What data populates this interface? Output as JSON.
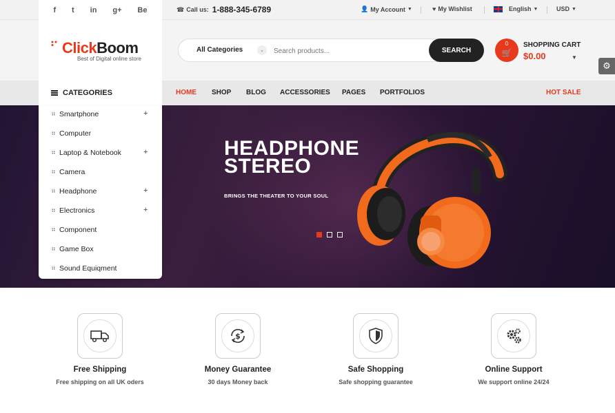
{
  "topbar": {
    "social": [
      "f",
      "t",
      "in",
      "g+",
      "Be"
    ],
    "call_label": "Call us:",
    "phone": "1-888-345-6789",
    "account": "My Account",
    "wishlist": "My Wishlist",
    "language": "English",
    "currency": "USD"
  },
  "header": {
    "logo_part1": "Click",
    "logo_part2": "Boom",
    "tagline": "Best of Digital online store",
    "search_category": "All Categories",
    "search_placeholder": "Search products...",
    "search_button": "SEARCH",
    "cart_count": "0",
    "cart_title": "SHOPPING CART",
    "cart_total": "$0.00"
  },
  "nav": {
    "categories_label": "CATEGORIES",
    "items": [
      "HOME",
      "SHOP",
      "BLOG",
      "ACCESSORIES",
      "PAGES",
      "PORTFOLIOS"
    ],
    "hot_sale": "HOT SALE"
  },
  "categories": [
    {
      "label": "Smartphone",
      "expand": "+"
    },
    {
      "label": "Computer",
      "expand": ""
    },
    {
      "label": "Laptop & Notebook",
      "expand": "+"
    },
    {
      "label": "Camera",
      "expand": ""
    },
    {
      "label": "Headphone",
      "expand": "+"
    },
    {
      "label": "Electronics",
      "expand": "+"
    },
    {
      "label": "Component",
      "expand": ""
    },
    {
      "label": "Game Box",
      "expand": ""
    },
    {
      "label": "Sound Equiqment",
      "expand": ""
    }
  ],
  "banner": {
    "line1": "HEADPHONE",
    "line2": "STEREO",
    "subtitle": "BRINGS THE THEATER TO YOUR SOUL",
    "slides": 3,
    "active_slide": 1
  },
  "features": [
    {
      "title": "Free Shipping",
      "subtitle": "Free shipping on all UK oders",
      "icon": "truck-icon"
    },
    {
      "title": "Money Guarantee",
      "subtitle": "30 days Money back",
      "icon": "dollar-refresh-icon"
    },
    {
      "title": "Safe Shopping",
      "subtitle": "Safe shopping guarantee",
      "icon": "shield-icon"
    },
    {
      "title": "Online Support",
      "subtitle": "We support online 24/24",
      "icon": "gears-icon"
    }
  ],
  "colors": {
    "accent": "#e8391c",
    "dark": "#222222"
  }
}
